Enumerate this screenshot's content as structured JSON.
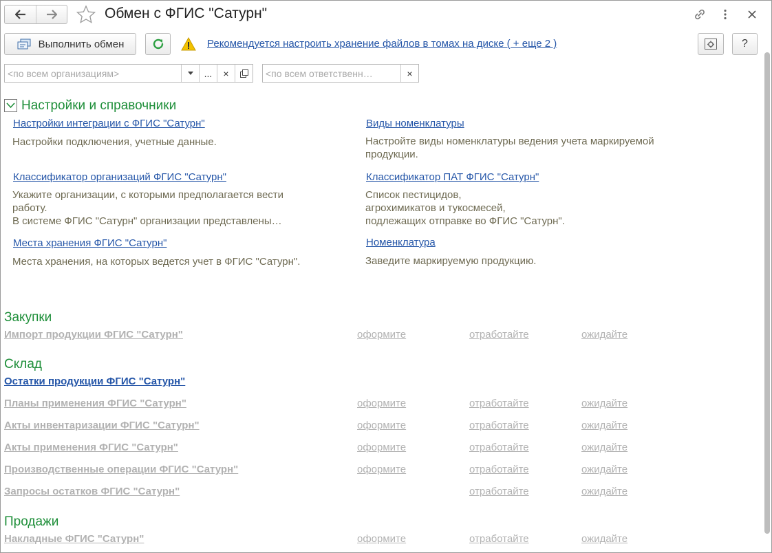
{
  "window": {
    "title": "Обмен с ФГИС \"Сатурн\""
  },
  "toolbar": {
    "exchange_label": "Выполнить обмен",
    "warning_link": "Рекомендуется настроить хранение файлов в томах на диске ( + еще 2 )",
    "help_label": "?"
  },
  "filters": {
    "org_placeholder": "<по всем организациям>",
    "resp_placeholder": "<по всем ответственн…",
    "more_label": "...",
    "clear_label": "×"
  },
  "settings": {
    "title": "Настройки и справочники",
    "left": [
      {
        "link": "Настройки интеграции с ФГИС \"Сатурн\"",
        "desc": [
          "Настройки подключения, учетные данные."
        ]
      },
      {
        "link": "Классификатор организаций ФГИС \"Сатурн\"",
        "desc": [
          "Укажите организации, с которыми предполагается вести",
          "работу.",
          "В системе ФГИС \"Сатурн\" организации представлены…"
        ]
      },
      {
        "link": "Места хранения ФГИС \"Сатурн\"",
        "desc": [
          "Места хранения, на которых ведется учет в ФГИС \"Сатурн\"."
        ]
      }
    ],
    "right": [
      {
        "link": "Виды номенклатуры",
        "desc": [
          "Настройте виды номенклатуры ведения учета маркируемой",
          "продукции."
        ]
      },
      {
        "link": "Классификатор ПАТ ФГИС \"Сатурн\"",
        "desc": [
          "Список пестицидов,",
          "агрохимикатов и тукосмесей,",
          "подлежащих отправке во ФГИС \"Сатурн\"."
        ]
      },
      {
        "link": "Номенклатура",
        "desc": [
          "Заведите маркируемую продукцию."
        ]
      }
    ]
  },
  "status_labels": {
    "issue": "оформите",
    "process": "отработайте",
    "wait": "ожидайте"
  },
  "sections": {
    "purchases": {
      "title": "Закупки",
      "rows": [
        {
          "label": "Импорт продукции ФГИС \"Сатурн\""
        }
      ]
    },
    "warehouse": {
      "title": "Склад",
      "rows": [
        {
          "label": "Остатки продукции ФГИС \"Сатурн\""
        },
        {
          "label": "Планы применения ФГИС \"Сатурн\""
        },
        {
          "label": "Акты инвентаризации ФГИС \"Сатурн\""
        },
        {
          "label": "Акты применения ФГИС \"Сатурн\""
        },
        {
          "label": "Производственные операции ФГИС \"Сатурн\""
        },
        {
          "label": "Запросы остатков ФГИС \"Сатурн\""
        }
      ]
    },
    "sales": {
      "title": "Продажи",
      "rows": [
        {
          "label": "Накладные ФГИС \"Сатурн\""
        }
      ]
    }
  },
  "colors": {
    "link": "#2556a8",
    "section_green": "#1f8f3a",
    "disabled": "#b2b2b2",
    "desc": "#6e6a52",
    "warning": "#f2c200"
  },
  "icons": [
    "back-arrow-icon",
    "forward-arrow-icon",
    "star-icon",
    "link-icon",
    "more-vertical-icon",
    "close-icon",
    "exchange-icon",
    "refresh-icon",
    "warning-icon",
    "settings-icon",
    "open-form-icon",
    "collapse-icon"
  ]
}
